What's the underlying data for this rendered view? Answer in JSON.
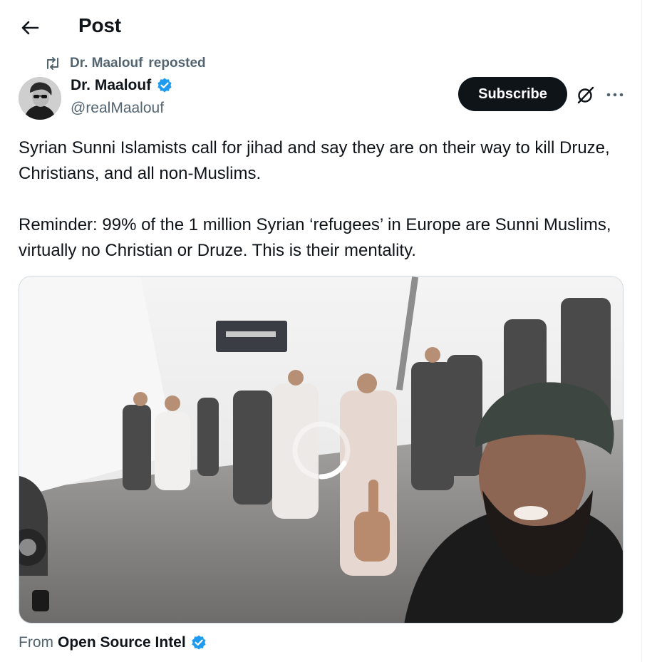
{
  "header": {
    "title": "Post",
    "back_icon": "arrow-left-icon"
  },
  "repost": {
    "user": "Dr. Maalouf",
    "verb": "reposted",
    "icon": "repost-icon"
  },
  "author": {
    "name": "Dr. Maalouf",
    "handle": "@realMaalouf",
    "verified": true,
    "verified_color": "#1d9bf0"
  },
  "actions": {
    "subscribe_label": "Subscribe",
    "grok_icon": "grok-icon",
    "more_icon": "more-icon"
  },
  "tweet": {
    "paragraph_1": "Syrian Sunni Islamists call for jihad and say they are on their way to kill Druze, Christians, and all non-Muslims.",
    "paragraph_2": "Reminder: 99% of the 1 million Syrian ‘refugees’ in Europe are Sunni Muslims, virtually no Christian or Druze. This is their mentality."
  },
  "media": {
    "type": "video",
    "loading": true
  },
  "from": {
    "label": "From",
    "source": "Open Source Intel",
    "verified": true
  },
  "colors": {
    "text": "#0f1419",
    "secondary": "#536471",
    "accent": "#1d9bf0",
    "button_bg": "#0f1419"
  }
}
